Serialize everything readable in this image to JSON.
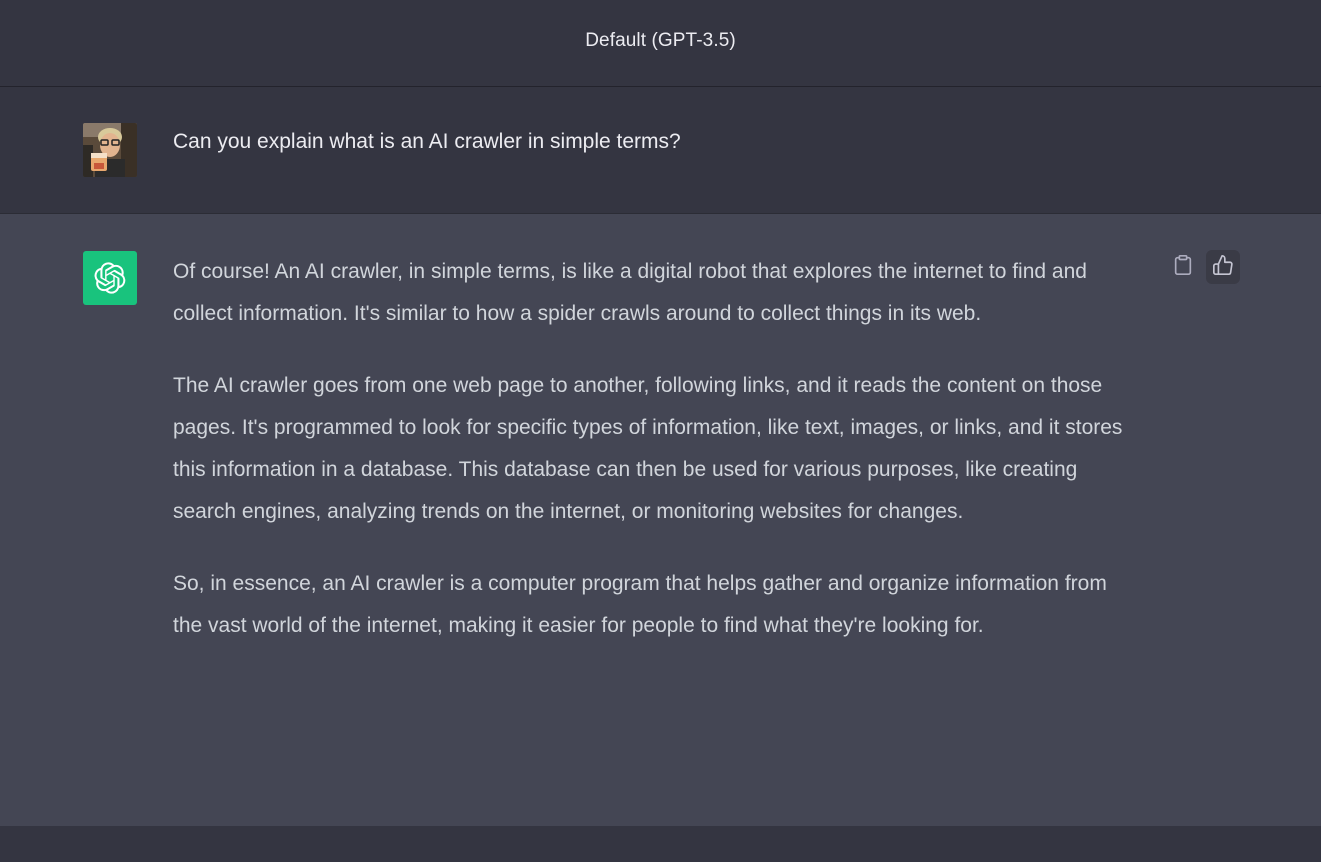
{
  "header": {
    "title": "Default (GPT-3.5)"
  },
  "user_message": {
    "text": "Can you explain what is an AI crawler in simple terms?",
    "avatar_icon": "user-photo-avatar"
  },
  "assistant_message": {
    "avatar_icon": "openai-logo-icon",
    "avatar_color": "#19c37d",
    "paragraphs": [
      "Of course! An AI crawler, in simple terms, is like a digital robot that explores the internet to find and collect information. It's similar to how a spider crawls around to collect things in its web.",
      "The AI crawler goes from one web page to another, following links, and it reads the content on those pages. It's programmed to look for specific types of information, like text, images, or links, and it stores this information in a database. This database can then be used for various purposes, like creating search engines, analyzing trends on the internet, or monitoring websites for changes.",
      "So, in essence, an AI crawler is a computer program that helps gather and organize information from the vast world of the internet, making it easier for people to find what they're looking for."
    ],
    "actions": {
      "copy_icon": "clipboard-icon",
      "thumbs_up_icon": "thumbs-up-icon"
    }
  },
  "colors": {
    "background": "#343541",
    "assistant_background": "#444654",
    "text_primary": "#ececf1",
    "text_assistant": "#d1d5db"
  }
}
